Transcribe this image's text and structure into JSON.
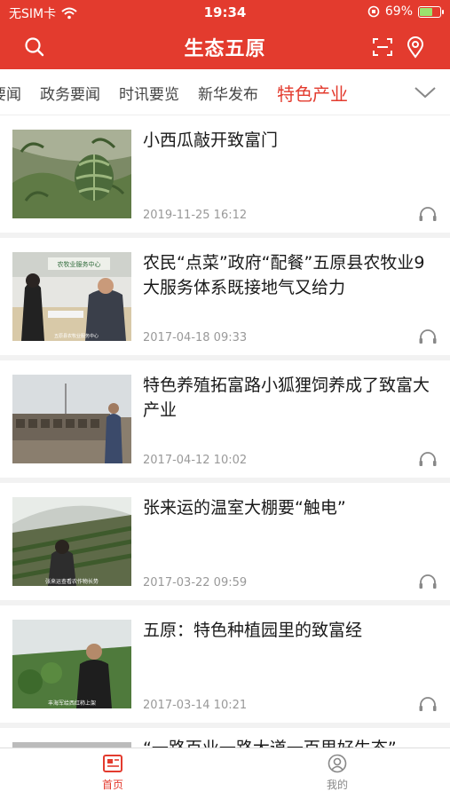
{
  "status_bar": {
    "carrier": "无SIM卡",
    "time": "19:34",
    "battery": "69%",
    "battery_level": 0.69
  },
  "header": {
    "title": "生态五原"
  },
  "tabs": [
    {
      "label": "要闻"
    },
    {
      "label": "政务要闻"
    },
    {
      "label": "时讯要览"
    },
    {
      "label": "新华发布"
    },
    {
      "label": "特色产业",
      "active": true
    }
  ],
  "articles": [
    {
      "title": "小西瓜敲开致富门",
      "date": "2019-11-25 16:12"
    },
    {
      "title": "农民“点菜”政府“配餐”五原县农牧业9大服务体系既接地气又给力",
      "date": "2017-04-18 09:33",
      "thumb_caption": "五原县农牧业服务中心",
      "thumb_sign": "农牧业服务中心"
    },
    {
      "title": "特色养殖拓富路小狐狸饲养成了致富大产业",
      "date": "2017-04-12 10:02"
    },
    {
      "title": "张来运的温室大棚要“触电”",
      "date": "2017-03-22 09:59",
      "thumb_caption": "张来运查看农作物长势"
    },
    {
      "title": "五原：特色种植园里的致富经",
      "date": "2017-03-14 10:21",
      "thumb_caption": "丰海军给西红柿上架"
    }
  ],
  "peek_article": {
    "title": "“一路百业一路大道一百里好生态”"
  },
  "tabbar": {
    "home": "首页",
    "mine": "我的"
  },
  "colors": {
    "brand": "#e33b2e",
    "muted": "#999999"
  }
}
